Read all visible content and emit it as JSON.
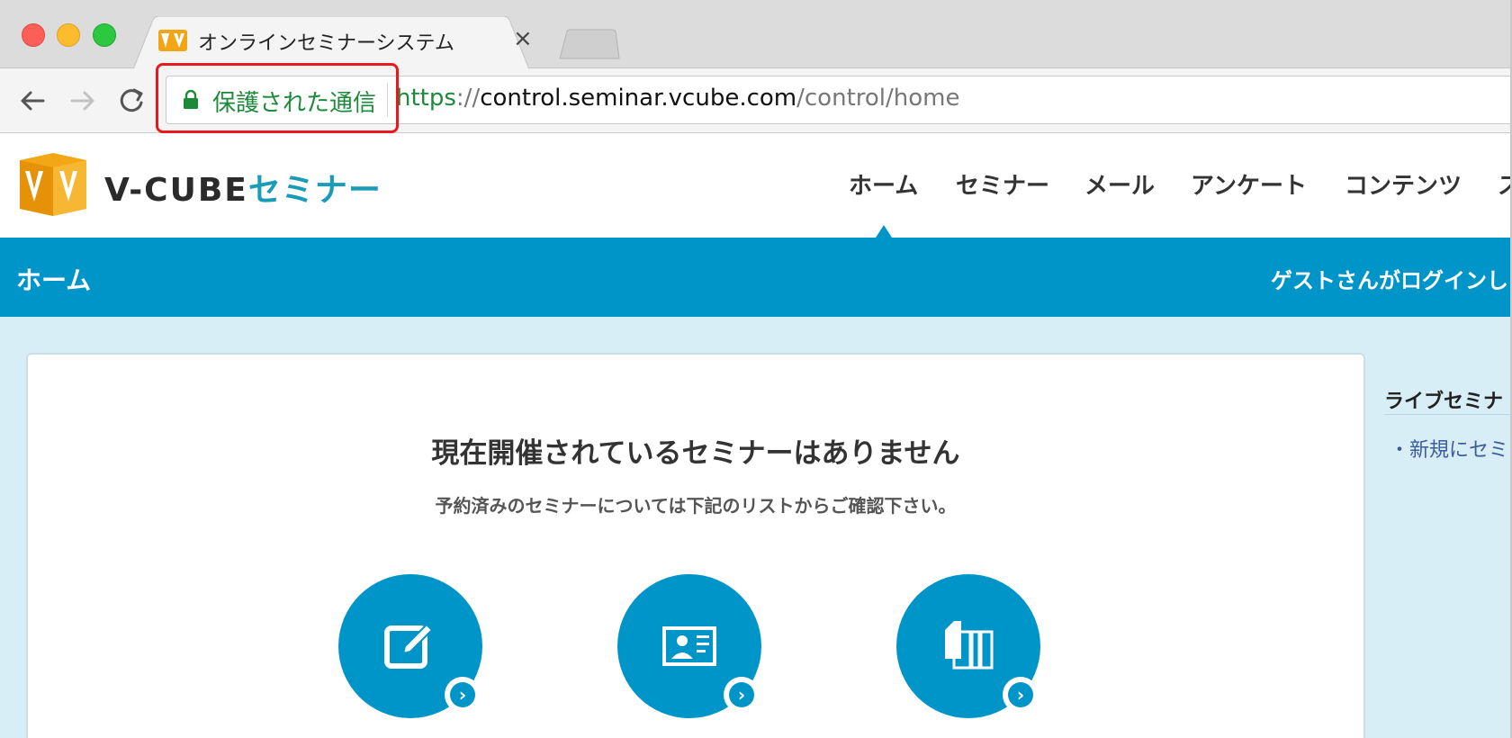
{
  "browser": {
    "tab": {
      "title": "オンラインセミナーシステム",
      "close_glyph": "×",
      "favicon": "vcube-logo-icon"
    },
    "toolbar": {
      "back": "arrow-left-icon",
      "forward": "arrow-right-icon",
      "reload": "reload-icon"
    },
    "address": {
      "security_label": "保護された通信",
      "url_scheme": "https",
      "url_separator": "://",
      "url_host": "control.seminar.vcube.com",
      "url_path": "/control/home"
    },
    "highlight_color": "#e8191e"
  },
  "site": {
    "logo": {
      "text": "V-CUBE",
      "accent_text": "セミナー"
    },
    "nav": [
      "ホーム",
      "セミナー",
      "メール",
      "アンケート",
      "コンテンツ",
      "ス"
    ],
    "active_nav_index": 0,
    "subbar": {
      "title": "ホーム",
      "user_status": "ゲストさんがログインし"
    },
    "main": {
      "headline": "現在開催されているセミナーはありません",
      "subtext": "予約済みのセミナーについては下記のリストからご確認下さい。",
      "tiles": [
        {
          "icon": "edit-icon",
          "arrow": "›"
        },
        {
          "icon": "id-card-icon",
          "arrow": "›"
        },
        {
          "icon": "documents-icon",
          "arrow": "›"
        }
      ]
    },
    "sidebar": {
      "title": "ライブセミナ",
      "link": "・新規にセミ"
    },
    "colors": {
      "primary": "#0095c8",
      "background": "#d8eef6",
      "secure_green": "#1d8a3a"
    }
  }
}
